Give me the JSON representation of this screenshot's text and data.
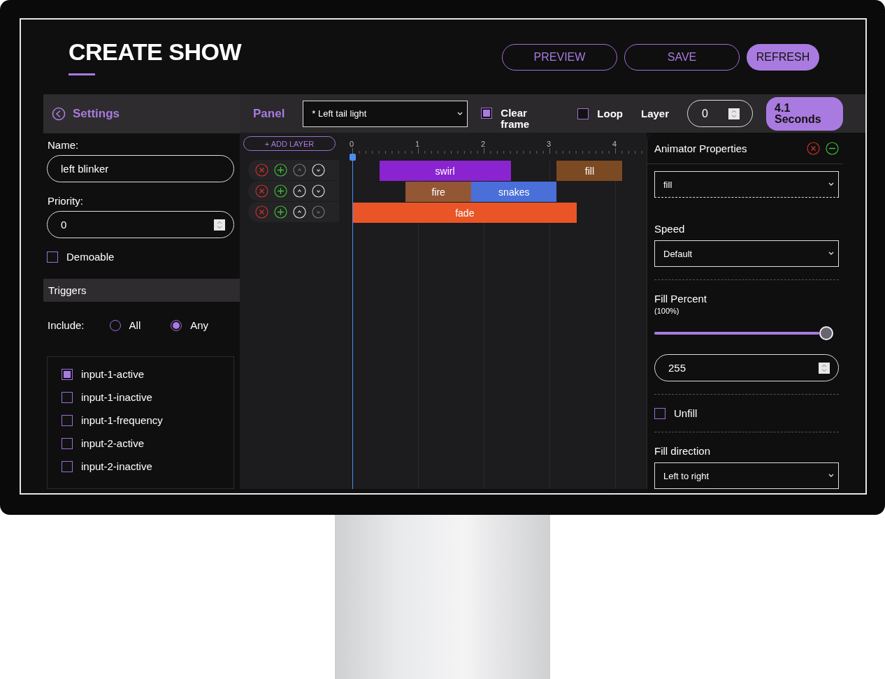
{
  "header": {
    "title": "CREATE SHOW",
    "buttons": [
      {
        "label": "PREVIEW",
        "kind": "outline"
      },
      {
        "label": "SAVE",
        "kind": "outline"
      },
      {
        "label": "REFRESH",
        "kind": "filled"
      }
    ]
  },
  "settings": {
    "title": "Settings",
    "name_label": "Name:",
    "name_value": "left blinker",
    "priority_label": "Priority:",
    "priority_value": "0",
    "demoable": {
      "label": "Demoable",
      "checked": false
    }
  },
  "triggers": {
    "title": "Triggers",
    "include_label": "Include:",
    "include_options": [
      {
        "label": "All",
        "selected": false
      },
      {
        "label": "Any",
        "selected": true
      }
    ],
    "items": [
      {
        "label": "input-1-active",
        "checked": true
      },
      {
        "label": "input-1-inactive",
        "checked": false
      },
      {
        "label": "input-1-frequency",
        "checked": false
      },
      {
        "label": "input-2-active",
        "checked": false
      },
      {
        "label": "input-2-inactive",
        "checked": false
      }
    ]
  },
  "toolbar": {
    "panel_label": "Panel",
    "panel_select": "* Left tail light",
    "clear_frame": {
      "label": "Clear frame",
      "checked": true
    },
    "loop": {
      "label": "Loop",
      "checked": false
    },
    "layer_label": "Layer",
    "layer_value": "0",
    "duration": "4.1 Seconds"
  },
  "timeline": {
    "add_layer": "+ ADD LAYER",
    "ticks": [
      "0",
      "1",
      "2",
      "3",
      "4"
    ],
    "layers": [
      {
        "up_disabled": true,
        "down_disabled": false,
        "clips": [
          {
            "label": "swirl",
            "color": "#8a24d0"
          },
          {
            "label": "fill",
            "color": "#7c4a22"
          }
        ]
      },
      {
        "up_disabled": false,
        "down_disabled": false,
        "clips": [
          {
            "label": "fire",
            "color": "#935736"
          },
          {
            "label": "snakes",
            "color": "#4a6fd8"
          }
        ]
      },
      {
        "up_disabled": false,
        "down_disabled": true,
        "clips": [
          {
            "label": "fade",
            "color": "#e95527"
          }
        ]
      }
    ]
  },
  "animator": {
    "title": "Animator Properties",
    "type_select": "fill",
    "speed_label": "Speed",
    "speed_select": "Default",
    "fill_percent_label": "Fill Percent",
    "fill_percent_value": "(100%)",
    "fill_slider": {
      "level": 1
    },
    "fill_number": "255",
    "unfill": {
      "label": "Unfill",
      "checked": false
    },
    "direction_label": "Fill direction",
    "direction_select": "Left to right"
  }
}
